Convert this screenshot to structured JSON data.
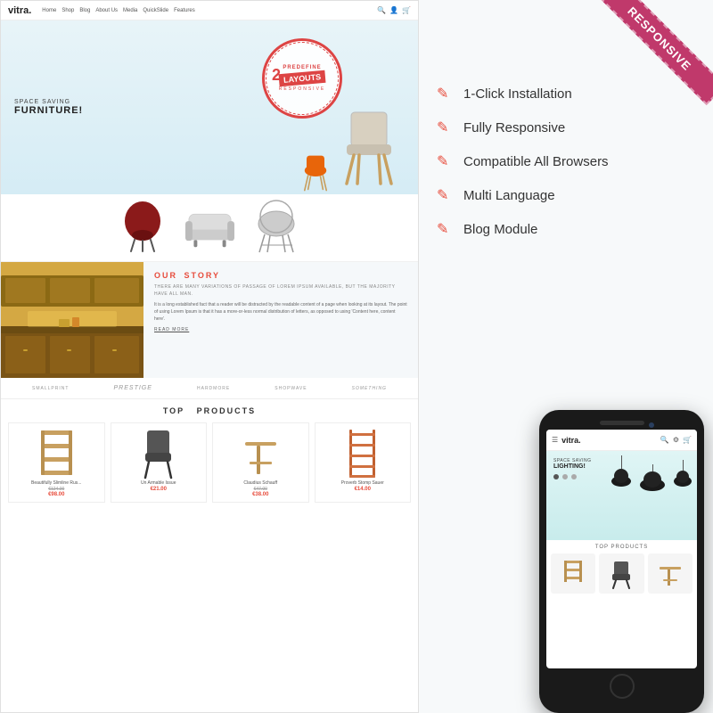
{
  "left": {
    "logo": "vitra.",
    "nav": [
      "Home",
      "Shop",
      "Blog",
      "About Us",
      "Media",
      "QuickSlide",
      "Features"
    ],
    "hero": {
      "line1": "SPACE SAVING",
      "line2": "FURNITURE!"
    },
    "stamp": {
      "predefine": "PREDEFINE",
      "number": "2",
      "layouts": "LAYOUTS",
      "responsive": "RESPONSIVE"
    },
    "story": {
      "title_color": "OUR",
      "title_rest": "STORY",
      "lorem": "THERE ARE MANY VARIATIONS OF PASSAGE OF LOREM IPSUM AVAILABLE, BUT THE MAJORITY HAVE ALL MAN.",
      "body": "It is a long established fact that a reader will be distracted by the readable content of a page when looking at its layout. The point of using Lorem Ipsum is that it has a more-or-less normal distribution of letters, as opposed to using 'Content here, content here'.",
      "read_more": "READ MORE"
    },
    "brands": [
      "SmallPrint",
      "Prestige",
      "Hardcore",
      "Shopwave",
      "Something"
    ],
    "top_products_title": "TOP",
    "top_products_title2": "PRODUCTS",
    "products": [
      {
        "name": "Beautifully Slimline Rus...",
        "price_old": "€124.00",
        "price_new": "€98.00"
      },
      {
        "name": "Un Armable Issue",
        "price_old": "",
        "price_new": "€21.00"
      },
      {
        "name": "Claudius Schauff",
        "price_old": "€47.00",
        "price_new": "€38.00"
      },
      {
        "name": "Proverb Stomp Sauer",
        "price_old": "",
        "price_new": "€14.00"
      }
    ]
  },
  "right": {
    "responsive_label": "RESPONSIVE",
    "features": [
      {
        "id": "feature-1",
        "text": "1-Click Installation"
      },
      {
        "id": "feature-2",
        "text": "Fully Responsive"
      },
      {
        "id": "feature-3",
        "text": "Compatible All Browsers"
      },
      {
        "id": "feature-4",
        "text": "Multi Language"
      },
      {
        "id": "feature-5",
        "text": "Blog Module"
      }
    ],
    "phone": {
      "logo": "vitra.",
      "hero_line1": "SPACE SAVING",
      "hero_line2": "LIGHTING!"
    }
  }
}
